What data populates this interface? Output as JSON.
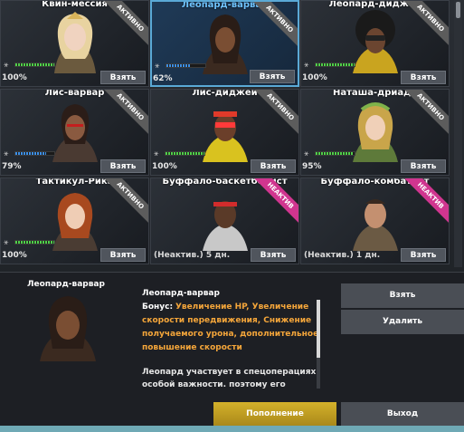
{
  "cards": [
    {
      "name": "Квин-мессия",
      "percent": "100%",
      "status": "АКТИВНО",
      "take": "Взять",
      "progress": 100,
      "bar": "green"
    },
    {
      "name": "Леопард-варвар",
      "percent": "62%",
      "status": "АКТИВНО",
      "take": "Взять",
      "progress": 62,
      "bar": "blue"
    },
    {
      "name": "Леопард-диджей",
      "percent": "100%",
      "status": "АКТИВНО",
      "take": "Взять",
      "progress": 100,
      "bar": "green"
    },
    {
      "name": "Лис-варвар",
      "percent": "79%",
      "status": "АКТИВНО",
      "take": "Взять",
      "progress": 79,
      "bar": "blue"
    },
    {
      "name": "Лис-диджей",
      "percent": "100%",
      "status": "АКТИВНО",
      "take": "Взять",
      "progress": 100,
      "bar": "green"
    },
    {
      "name": "Наташа-дриада",
      "percent": "95%",
      "status": "АКТИВНО",
      "take": "Взять",
      "progress": 95,
      "bar": "green"
    },
    {
      "name": "Тактикул-Рика",
      "percent": "100%",
      "status": "АКТИВНО",
      "take": "Взять",
      "progress": 100,
      "bar": "green"
    },
    {
      "name": "Буффало-баскетболист",
      "inactive_text": "(Неактив.) 5 дн.",
      "status": "НЕАКТИВ",
      "take": "Взять"
    },
    {
      "name": "Буффало-комбатант",
      "inactive_text": "(Неактив.) 1 дн.",
      "status": "НЕАКТИВ",
      "take": "Взять"
    }
  ],
  "panel": {
    "selected_name": "Леопард-варвар",
    "info_title": "Леопард-варвар",
    "bonus_label": "Бонус:",
    "bonus_value": "Увеличение HP, Увеличение скорости передвижения, Снижение получаемого урона, дополнительное повышение скорости",
    "description": "Леопард участвует в спецоперациях особой важности. поэтому его",
    "take_button": "Взять",
    "delete_button": "Удалить",
    "replenish_button": "Пополнение",
    "exit_button": "Выход"
  },
  "colors": {
    "accent_gold": "#d4b12b",
    "selected_border": "#5aa9d6",
    "bonus_orange": "#f5a63a",
    "inactive_pink": "#d0358f"
  }
}
